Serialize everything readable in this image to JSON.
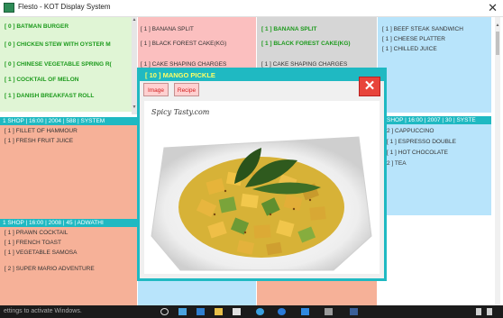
{
  "window": {
    "title": "Flesto - KOT Display System",
    "close": "✕"
  },
  "col1": {
    "items": [
      "[ 0 ] BATMAN BURGER",
      "[ 0 ] CHICKEN STEW WITH OYSTER M",
      "[ 0 ] CHINESE VEGETABLE SPRING R(",
      "[ 1 ] COCKTAIL OF MELON",
      "[ 1 ] DANISH BREAKFAST ROLL"
    ],
    "header2": "1  SHOP  | 16:00  | 2004 | 588  | SYSTEM",
    "items2": [
      "[ 1 ] FILLET OF HAMMOUR",
      "[ 1 ] FRESH FRUIT JUICE"
    ],
    "header3": "1  SHOP  | 16:00  | 2008 | 45  | ADWATHI",
    "items3": [
      "[ 1 ] PRAWN COCKTAIL",
      "[ 1 ] FRENCH TOAST",
      "[ 1 ] VEGETABLE SAMOSA",
      "[ 2 ] SUPER MARIO ADVENTURE"
    ]
  },
  "col2": {
    "items": [
      "[ 1 ] BANANA SPLIT",
      "[ 1 ] BLACK FOREST CAKE(KG)",
      "[ 1 ] CAKE SHAPING CHARGES"
    ]
  },
  "col3": {
    "items": [
      "[ 1 ] BANANA SPLIT",
      "[ 1 ] BLACK FOREST CAKE(KG)",
      "[ 1 ] CAKE SHAPING CHARGES"
    ]
  },
  "col4": {
    "items": [
      "[ 1 ] BEEF STEAK SANDWICH",
      "[ 1 ] CHEESE PLATTER",
      "[ 1 ] CHILLED JUICE"
    ],
    "header2": "SHOP  | 16:00  | 2007 | 30  | SYSTE",
    "items2": [
      "2 ] CAPPUCCINO",
      "[ 1 ] ESPRESSO DOUBLE",
      "[ 1 ] HOT CHOCOLATE",
      "2 ] TEA"
    ]
  },
  "modal": {
    "title": "[ 10 ]  MANGO PICKLE",
    "image_tab": "Image",
    "recipe_tab": "Recipe",
    "watermark": "Spicy Tasty.com",
    "close": "✕"
  },
  "taskbar": {
    "text": "ettings to activate Windows."
  },
  "colors": {
    "green": "#e0f5d5",
    "pink": "#fbbfbf",
    "gray": "#d6d6d6",
    "blue": "#b8e4fb",
    "salmon": "#f6b198",
    "accent": "#1fb9c2"
  }
}
